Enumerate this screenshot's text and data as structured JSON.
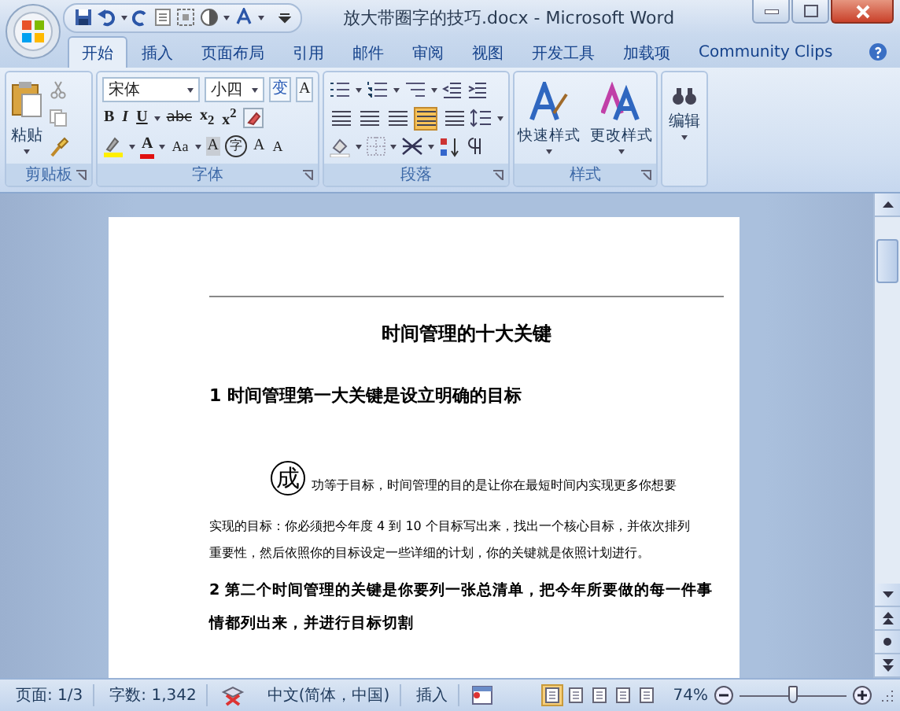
{
  "window": {
    "title": "放大带圈字的技巧.docx - Microsoft Word"
  },
  "tabs": [
    {
      "label": "开始",
      "selected": true
    },
    {
      "label": "插入",
      "selected": false
    },
    {
      "label": "页面布局",
      "selected": false
    },
    {
      "label": "引用",
      "selected": false
    },
    {
      "label": "邮件",
      "selected": false
    },
    {
      "label": "审阅",
      "selected": false
    },
    {
      "label": "视图",
      "selected": false
    },
    {
      "label": "开发工具",
      "selected": false
    },
    {
      "label": "加载项",
      "selected": false
    },
    {
      "label": "Community Clips",
      "selected": false
    }
  ],
  "ribbon": {
    "clipboard": {
      "label": "剪贴板",
      "paste": "粘贴"
    },
    "font": {
      "label": "字体",
      "font_name": "宋体",
      "font_size": "小四",
      "phonetic": "变",
      "border": "A",
      "bold": "B",
      "italic": "I",
      "underline": "U",
      "strike": "abc",
      "subscript": "x$_{2}$",
      "superscript": "x$^{2}$",
      "font_color": "A",
      "change_case": "Aa",
      "shading": "A",
      "enclose": "字",
      "grow": "A",
      "shrink": "A"
    },
    "paragraph": {
      "label": "段落",
      "alignment_buttons": [
        {
          "selected": false
        },
        {
          "selected": false
        },
        {
          "selected": false
        },
        {
          "selected": true
        },
        {
          "selected": false
        }
      ]
    },
    "styles": {
      "label": "样式",
      "quick_styles": "快速样式",
      "change_styles": "更改样式"
    },
    "editing": {
      "label": "编辑"
    }
  },
  "document": {
    "title": "时间管理的十大关键",
    "heading_1": "1  时间管理第一大关键是设立明确的目标",
    "enclosed_char": "成",
    "paragraph_lines": [
      "功等于目标，时间管理的目的是让你在最短时间内实现更多你想要",
      "实现的目标：你必须把今年度 4 到 10 个目标写出来，找出一个核心目标，并依次排列",
      "重要性，然后依照你的目标设定一些详细的计划，你的关键就是依照计划进行。"
    ],
    "heading_2_lines": [
      "2  第二个时间管理的关键是你要列一张总清单，把今年所要做的每一件事",
      "情都列出来，并进行目标切割"
    ]
  },
  "status_bar": {
    "page": "页面: 1/3",
    "words": "字数: 1,342",
    "language": "中文(简体，中国)",
    "mode": "插入",
    "view_buttons": [
      {
        "selected": true
      },
      {
        "selected": false
      },
      {
        "selected": false
      },
      {
        "selected": false
      },
      {
        "selected": false
      }
    ],
    "zoom": "74%",
    "zoom_slider": {
      "level": 0.5
    }
  }
}
